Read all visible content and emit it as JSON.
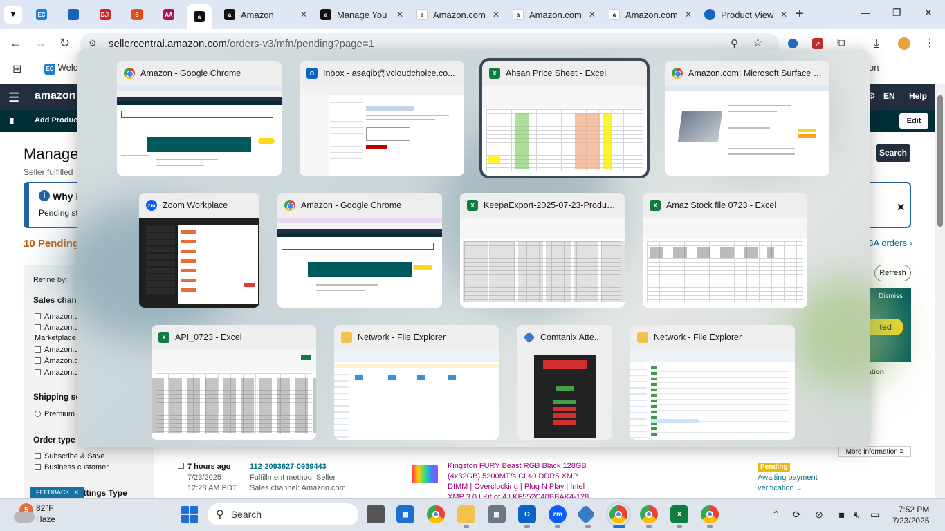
{
  "browser": {
    "tabs": [
      {
        "label": "Amazon",
        "active": true
      },
      {
        "label": "Amazon",
        "active": false
      },
      {
        "label": "Manage You",
        "active": false
      },
      {
        "label": "Amazon.com",
        "active": false
      },
      {
        "label": "Amazon.com",
        "active": false
      },
      {
        "label": "Amazon.com",
        "active": false
      },
      {
        "label": "Product View",
        "active": false
      }
    ],
    "pinned_tabs": [
      "EC",
      "DJI",
      "S",
      "AA"
    ],
    "url_host": "sellercentral.amazon.com",
    "url_path": "/orders-v3/mfn/pending?page=1",
    "bookmark_label": "Welc",
    "bookmark_right": "on"
  },
  "amazon_page": {
    "logo_text": "amazon se",
    "add_products": "Add Products",
    "language": "EN",
    "help": "Help",
    "edit": "Edit",
    "page_title": "Manage",
    "seller_fulfilled": "Seller fulfilled",
    "info_title": "Why i",
    "info_text": "Pending sta",
    "pending_count": "10 Pending",
    "search_btn": "Search",
    "fba_orders": "BA orders",
    "refresh": "Refresh",
    "dismiss": "Dismiss",
    "get_started": "ted",
    "action_label": "ation",
    "refine_by": "Refine by:",
    "sales_channel": "Sales channe",
    "channels": [
      "Amazon.co",
      "Amazon.co",
      "Marketplace",
      "Amazon.co",
      "Amazon.ca",
      "Amazon.co"
    ],
    "shipping_service": "Shipping ser",
    "premium": "Premium",
    "order_type": "Order type",
    "subscribe_save": "Subscribe & Save",
    "business_customer": "Business customer",
    "settings_type": "ng Settings Type",
    "more_info": "More information",
    "order": {
      "age": "7 hours ago",
      "date": "7/23/2025",
      "time": "12:28 AM PDT",
      "order_id": "112-2093627-0939443",
      "fulfillment": "Fulfillment method: Seller",
      "sales_channel": "Sales channel: Amazon.com",
      "product": "Kingston FURY Beast RGB Black 128GB (4x32GB) 5200MT/s CL40 DDR5 XMP DIMM | Overclocking | Plug N Play | Intel XMP 3.0 | Kit of 4 | KF552C40BBAK4-128",
      "status_badge": "Pending",
      "status_text": "Awaiting payment verification"
    },
    "feedback": "FEEDBACK"
  },
  "task_view": {
    "windows": [
      {
        "title": "Amazon - Google Chrome",
        "icon": "chrome-icon"
      },
      {
        "title": "Inbox - asaqib@vcloudchoice.co...",
        "icon": "outlook-icon"
      },
      {
        "title": "Ahsan Price Sheet - Excel",
        "icon": "excel-icon",
        "selected": true
      },
      {
        "title": "Amazon.com: Microsoft Surface P...",
        "icon": "chrome-icon"
      },
      {
        "title": "Zoom Workplace",
        "icon": "zoom-icon"
      },
      {
        "title": "Amazon - Google Chrome",
        "icon": "chrome-icon"
      },
      {
        "title": "KeepaExport-2025-07-23-Product...",
        "icon": "excel-icon"
      },
      {
        "title": "Amaz Stock file 0723 - Excel",
        "icon": "excel-icon"
      },
      {
        "title": "API_0723 - Excel",
        "icon": "excel-icon"
      },
      {
        "title": "Network - File Explorer",
        "icon": "folder-icon"
      },
      {
        "title": "Comtanix Atte...",
        "icon": "comtanix-icon"
      },
      {
        "title": "Network - File Explorer",
        "icon": "folder-icon"
      }
    ]
  },
  "taskbar": {
    "weather_temp": "82°F",
    "weather_cond": "Haze",
    "weather_badge": "5",
    "search_placeholder": "Search",
    "time": "7:52 PM",
    "date": "7/23/2025"
  },
  "colors": {
    "amazon_nav": "#232f3e",
    "amazon_sub": "#002f36",
    "pending_orange": "#c45500",
    "link_teal": "#007185",
    "excel_green": "#107c41",
    "selection_outline": "#3b4a59"
  }
}
